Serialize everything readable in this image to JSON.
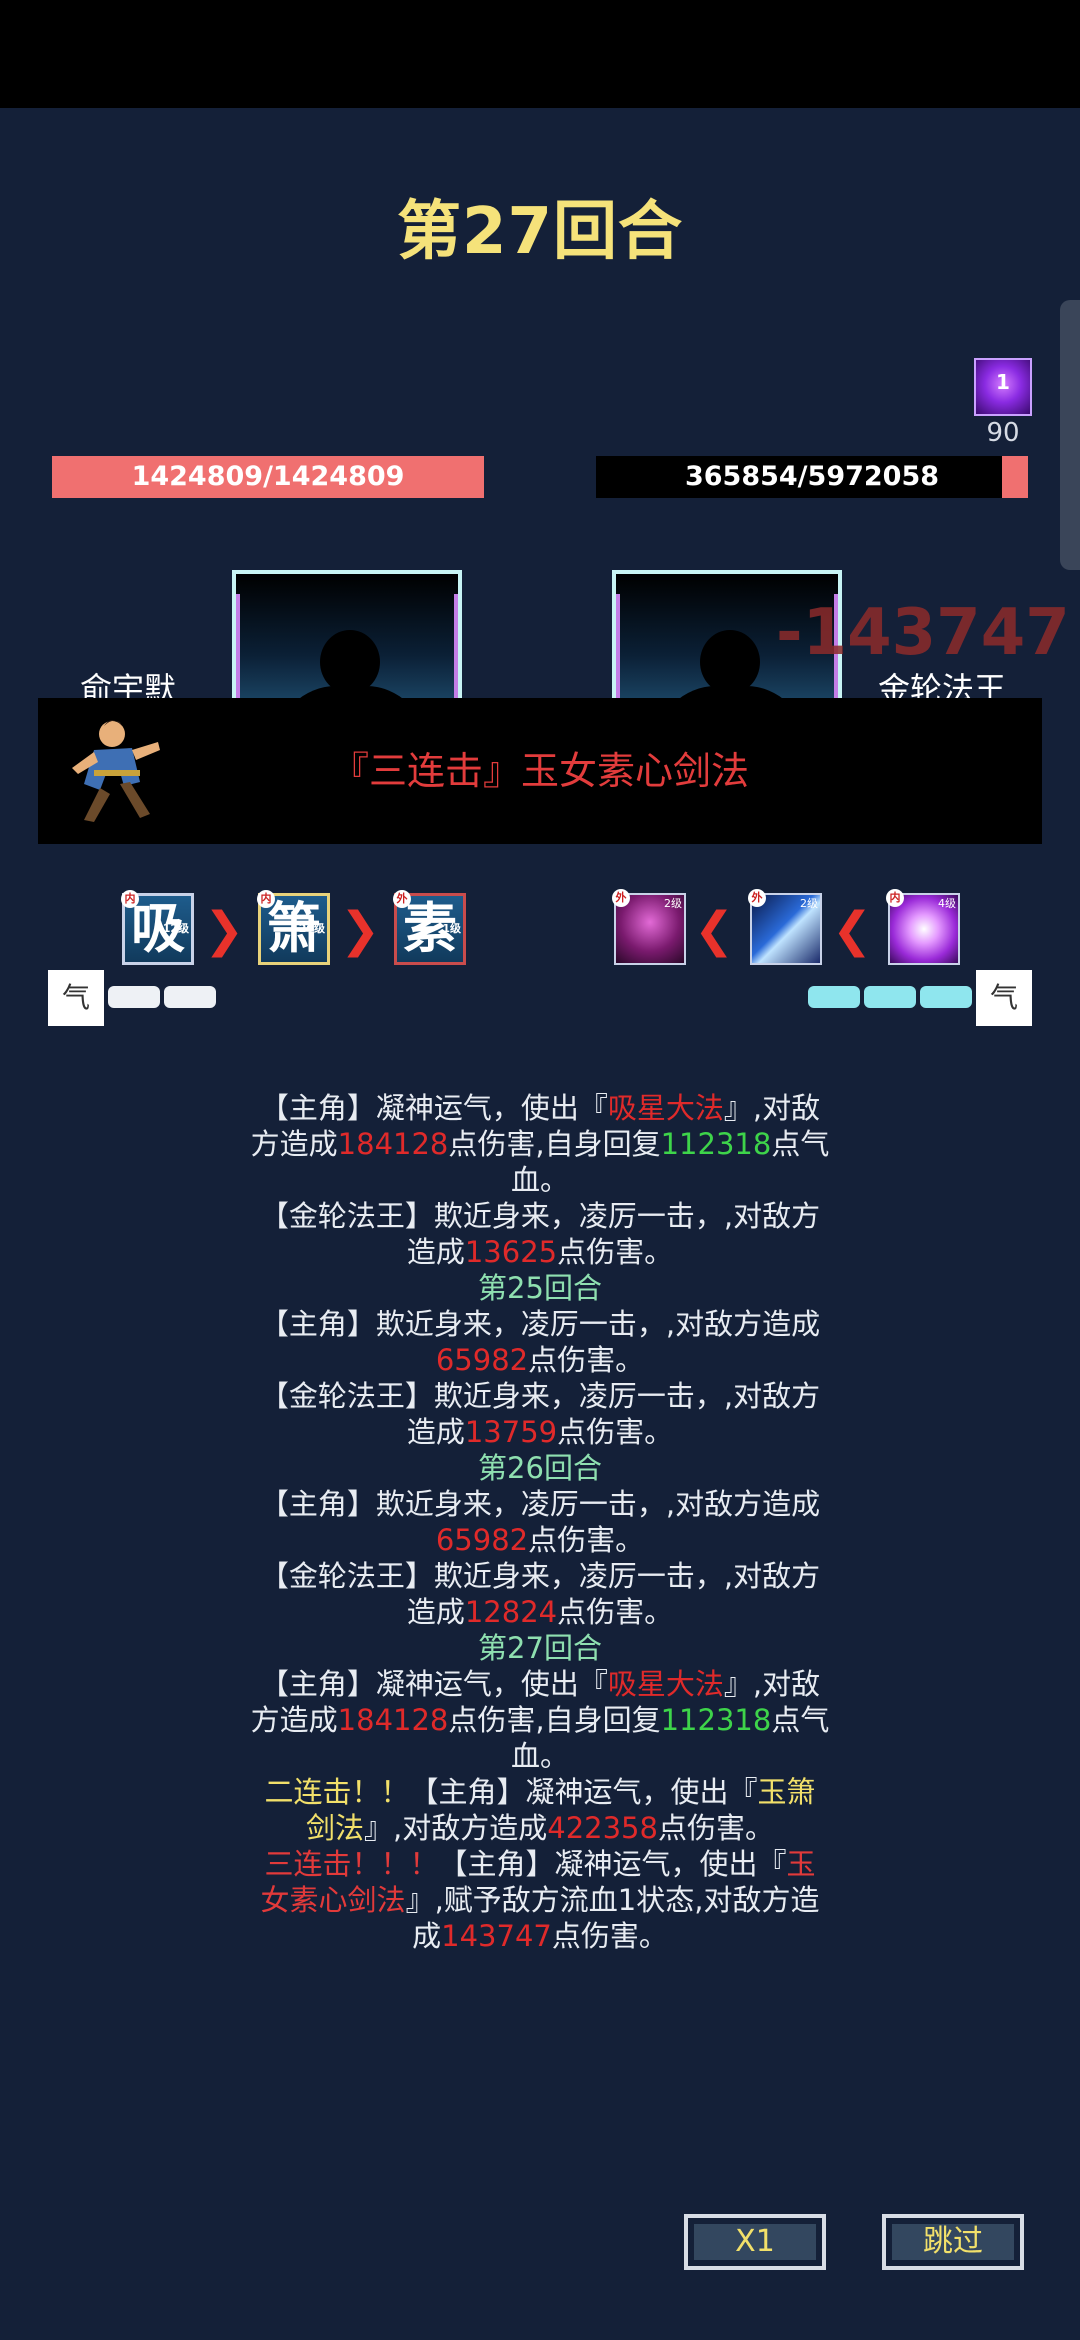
{
  "header": {
    "round_title": "第27回合"
  },
  "buff": {
    "count": "1",
    "turns": "90",
    "icon": "purple-energy-icon"
  },
  "player": {
    "name": "俞宇默",
    "hp_text": "1424809/1424809",
    "hp_fraction": 1.0
  },
  "enemy": {
    "name": "金轮法王",
    "hp_text": "365854/5972058",
    "hp_fraction": 0.061,
    "damage_popup": "-143747"
  },
  "skill_banner": {
    "text": "『三连击』玉女素心剑法"
  },
  "player_chain": [
    {
      "glyph": "吸",
      "badge": "内",
      "level": "12级"
    },
    {
      "glyph": "箫",
      "badge": "内",
      "level": "20级"
    },
    {
      "glyph": "素",
      "badge": "外",
      "level": "1级"
    }
  ],
  "enemy_chain": [
    {
      "badge": "外",
      "level": "2级",
      "icon": "dark-slash-icon"
    },
    {
      "badge": "外",
      "level": "2级",
      "icon": "blue-sword-icon"
    },
    {
      "badge": "内",
      "level": "4级",
      "icon": "purple-skull-icon"
    }
  ],
  "qi": {
    "label": "气",
    "player_pips": 2,
    "enemy_pips": 3
  },
  "log": [
    {
      "parts": [
        {
          "t": "【主角】凝神运气，使出『"
        },
        {
          "t": "吸星大法",
          "c": "r"
        },
        {
          "t": "』,对敌方造成"
        },
        {
          "t": "184128",
          "c": "r"
        },
        {
          "t": "点伤害,自身回复"
        },
        {
          "t": "112318",
          "c": "g"
        },
        {
          "t": "点气血。"
        }
      ]
    },
    {
      "parts": [
        {
          "t": "【金轮法王】欺近身来，凌厉一击，,对敌方造成"
        },
        {
          "t": "13625",
          "c": "r"
        },
        {
          "t": "点伤害。"
        }
      ]
    },
    {
      "round": "第25回合"
    },
    {
      "parts": [
        {
          "t": "【主角】欺近身来，凌厉一击，,对敌方造成"
        },
        {
          "t": "65982",
          "c": "r"
        },
        {
          "t": "点伤害。"
        }
      ]
    },
    {
      "parts": [
        {
          "t": "【金轮法王】欺近身来，凌厉一击，,对敌方造成"
        },
        {
          "t": "13759",
          "c": "r"
        },
        {
          "t": "点伤害。"
        }
      ]
    },
    {
      "round": "第26回合"
    },
    {
      "parts": [
        {
          "t": "【主角】欺近身来，凌厉一击，,对敌方造成"
        },
        {
          "t": "65982",
          "c": "r"
        },
        {
          "t": "点伤害。"
        }
      ]
    },
    {
      "parts": [
        {
          "t": "【金轮法王】欺近身来，凌厉一击，,对敌方造成"
        },
        {
          "t": "12824",
          "c": "r"
        },
        {
          "t": "点伤害。"
        }
      ]
    },
    {
      "round": "第27回合"
    },
    {
      "parts": [
        {
          "t": "【主角】凝神运气，使出『"
        },
        {
          "t": "吸星大法",
          "c": "r"
        },
        {
          "t": "』,对敌方造成"
        },
        {
          "t": "184128",
          "c": "r"
        },
        {
          "t": "点伤害,自身回复"
        },
        {
          "t": "112318",
          "c": "g"
        },
        {
          "t": "点气血。"
        }
      ]
    },
    {
      "parts": [
        {
          "t": "二连击！！",
          "c": "y"
        },
        {
          "t": "【主角】凝神运气，使出『"
        },
        {
          "t": "玉箫剑法",
          "c": "y"
        },
        {
          "t": "』,对敌方造成"
        },
        {
          "t": "422358",
          "c": "r"
        },
        {
          "t": "点伤害。"
        }
      ]
    },
    {
      "parts": [
        {
          "t": "三连击！！！",
          "c": "rd"
        },
        {
          "t": "【主角】凝神运气，使出『"
        },
        {
          "t": "玉女素心剑法",
          "c": "rd"
        },
        {
          "t": "』,赋予敌方流血1状态,对敌方造成"
        },
        {
          "t": "143747",
          "c": "r"
        },
        {
          "t": "点伤害。"
        }
      ]
    }
  ],
  "buttons": {
    "speed": "X1",
    "skip": "跳过"
  },
  "colors": {
    "hp": "#f07070",
    "damage": "#e02a2a",
    "heal": "#3ed44a",
    "title": "#f5e27a"
  }
}
